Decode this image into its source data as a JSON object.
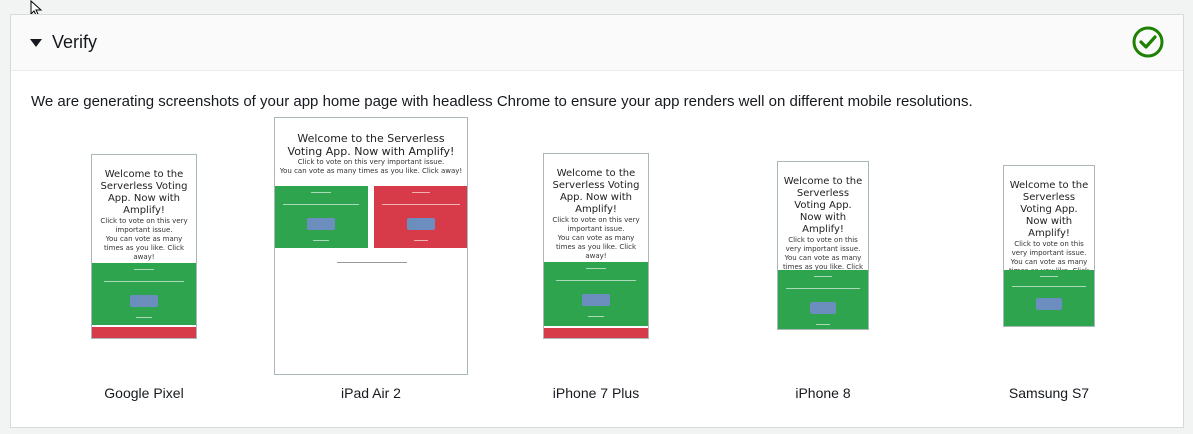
{
  "section": {
    "title": "Verify",
    "description": "We are generating screenshots of your app home page with headless Chrome to ensure your app renders well on different mobile resolutions."
  },
  "app": {
    "heading_narrow": "Welcome to the Serverless Voting App. Now with Amplify!",
    "heading_wide": "Welcome to the Serverless Voting App. Now with Amplify!",
    "subtext_1": "Click to vote on this very important issue.",
    "subtext_2": "You can vote as many times as you like. Click away!"
  },
  "devices": [
    {
      "label": "Google Pixel"
    },
    {
      "label": "iPad Air 2"
    },
    {
      "label": "iPhone 7 Plus"
    },
    {
      "label": "iPhone 8"
    },
    {
      "label": "Samsung S7"
    }
  ],
  "colors": {
    "success": "#1d8102",
    "vote_green": "#2ea44f",
    "vote_red": "#d73a49"
  },
  "icons": {
    "collapse": "caret-down-icon",
    "status": "check-circle-icon",
    "pointer": "mouse-cursor-icon"
  }
}
